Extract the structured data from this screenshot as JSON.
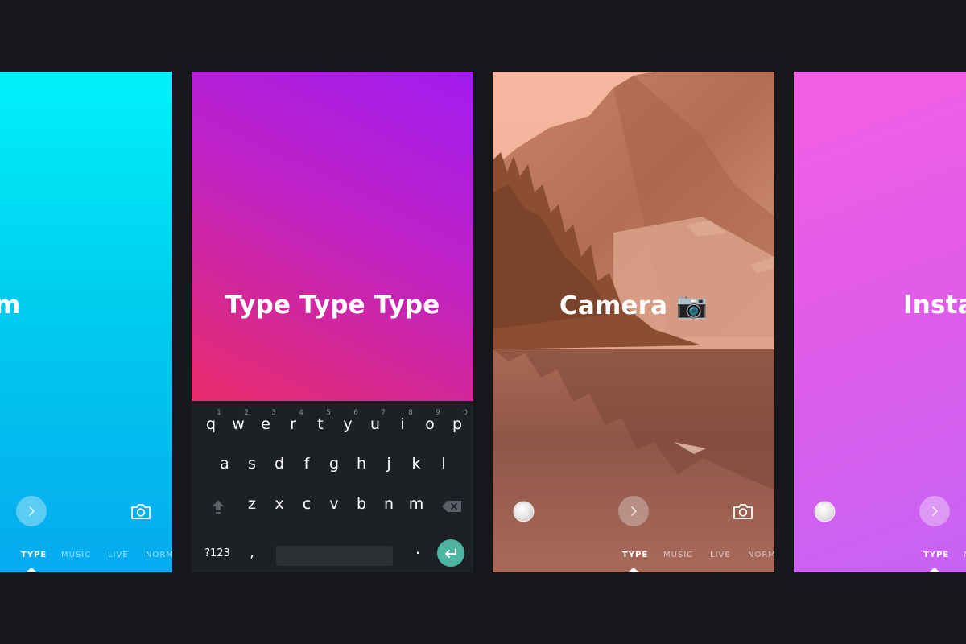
{
  "screens": {
    "left": {
      "title": "gram",
      "nav": [
        "TYPE",
        "MUSIC",
        "LIVE",
        "NORM"
      ],
      "active": "TYPE"
    },
    "keyboard_screen": {
      "title": "Type Type Type",
      "keyboard": {
        "row1": [
          {
            "key": "q",
            "hint": "1"
          },
          {
            "key": "w",
            "hint": "2"
          },
          {
            "key": "e",
            "hint": "3"
          },
          {
            "key": "r",
            "hint": "4"
          },
          {
            "key": "t",
            "hint": "5"
          },
          {
            "key": "y",
            "hint": "6"
          },
          {
            "key": "u",
            "hint": "7"
          },
          {
            "key": "i",
            "hint": "8"
          },
          {
            "key": "o",
            "hint": "9"
          },
          {
            "key": "p",
            "hint": "0"
          }
        ],
        "row2": [
          "a",
          "s",
          "d",
          "f",
          "g",
          "h",
          "j",
          "k",
          "l"
        ],
        "row3": [
          "z",
          "x",
          "c",
          "v",
          "b",
          "n",
          "m"
        ],
        "symbols_label": "?123",
        "comma": ",",
        "period": "."
      }
    },
    "camera": {
      "title": "Camera 📷",
      "nav": [
        "TYPE",
        "MUSIC",
        "LIVE",
        "NORM"
      ],
      "active": "TYPE"
    },
    "right": {
      "title": "Insta",
      "nav": [
        "TYPE",
        "M"
      ],
      "active": "TYPE"
    }
  },
  "colors": {
    "background": "#15171b",
    "enter_key": "#4db6a3",
    "keyboard_bg": "#1d2125"
  },
  "icons": [
    "chevron-right-icon",
    "camera-icon",
    "shift-icon",
    "backspace-icon",
    "enter-icon",
    "record-icon"
  ]
}
